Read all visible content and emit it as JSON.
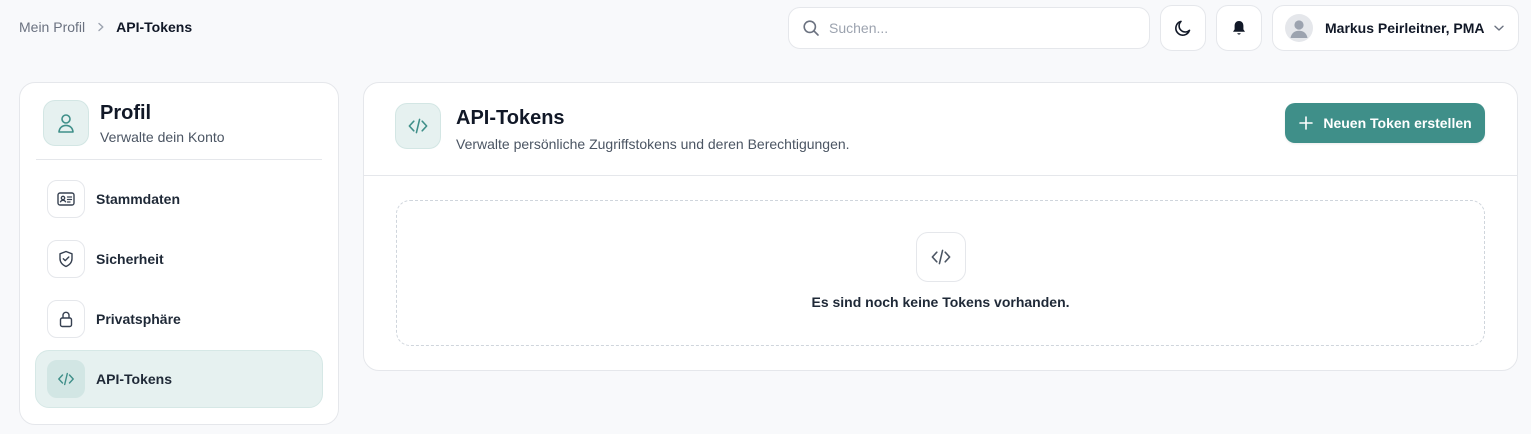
{
  "breadcrumb": {
    "parent": "Mein Profil",
    "current": "API-Tokens",
    "separator_icon": "chevron-right-icon"
  },
  "header": {
    "search": {
      "placeholder": "Suchen...",
      "value": "",
      "icon": "search-icon"
    },
    "theme_toggle_icon": "moon-icon",
    "notifications_icon": "bell-icon",
    "user": {
      "name": "Markus Peirleitner, PMA",
      "avatar_icon": "user-avatar-icon",
      "chevron_icon": "chevron-down-icon"
    }
  },
  "sidebar": {
    "title": "Profil",
    "subtitle": "Verwalte dein Konto",
    "icon": "user-icon",
    "items": [
      {
        "label": "Stammdaten",
        "icon": "id-card-icon",
        "active": false
      },
      {
        "label": "Sicherheit",
        "icon": "shield-check-icon",
        "active": false
      },
      {
        "label": "Privatsphäre",
        "icon": "lock-icon",
        "active": false
      },
      {
        "label": "API-Tokens",
        "icon": "code-icon",
        "active": true
      }
    ]
  },
  "main": {
    "title": "API-Tokens",
    "subtitle": "Verwalte persönliche Zugriffstokens und deren Berechtigungen.",
    "icon": "code-icon",
    "create_button": {
      "label": "Neuen Token erstellen",
      "icon": "plus-icon"
    },
    "empty_state": {
      "icon": "code-icon",
      "message": "Es sind noch keine Tokens vorhanden."
    }
  },
  "colors": {
    "accent": "#3f8f89",
    "accent_light": "#e6f1f0",
    "background": "#f8f9fb",
    "border": "#e5e7eb",
    "text_primary": "#111827",
    "text_secondary": "#4b5563"
  }
}
